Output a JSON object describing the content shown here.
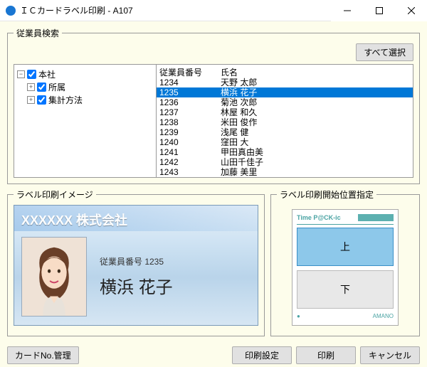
{
  "window": {
    "title": "ＩＣカードラベル印刷 - A107"
  },
  "search": {
    "legend": "従業員検索",
    "select_all": "すべて選択",
    "tree": {
      "root": "本社",
      "child1": "所属",
      "child2": "集計方法"
    },
    "columns": {
      "id": "従業員番号",
      "name": "氏名"
    },
    "rows": [
      {
        "id": "1234",
        "name": "天野 太郎",
        "selected": false
      },
      {
        "id": "1235",
        "name": "横浜 花子",
        "selected": true
      },
      {
        "id": "1236",
        "name": "菊池 次郎",
        "selected": false
      },
      {
        "id": "1237",
        "name": "林屋 和久",
        "selected": false
      },
      {
        "id": "1238",
        "name": "米田 俊作",
        "selected": false
      },
      {
        "id": "1239",
        "name": "浅尾 健",
        "selected": false
      },
      {
        "id": "1240",
        "name": "窪田 大",
        "selected": false
      },
      {
        "id": "1241",
        "name": "甲田真由美",
        "selected": false
      },
      {
        "id": "1242",
        "name": "山田千佳子",
        "selected": false
      },
      {
        "id": "1243",
        "name": "加藤 美里",
        "selected": false
      }
    ]
  },
  "preview": {
    "legend": "ラベル印刷イメージ",
    "company": "XXXXXX 株式会社",
    "emp_id_label": "従業員番号 1235",
    "emp_name": "横浜 花子"
  },
  "position": {
    "legend": "ラベル印刷開始位置指定",
    "brand": "Time P@CK-ic",
    "top": "上",
    "bottom": "下",
    "amano": "AMANO"
  },
  "buttons": {
    "card_no": "カードNo.管理",
    "settings": "印刷設定",
    "print": "印刷",
    "cancel": "キャンセル"
  }
}
